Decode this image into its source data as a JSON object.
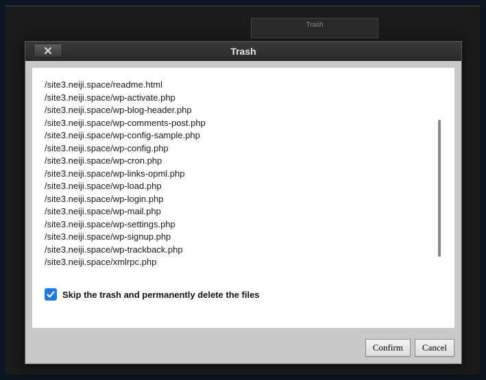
{
  "background": {
    "tab_label": "Trash"
  },
  "dialog": {
    "title": "Trash",
    "files": [
      "/site3.neiji.space/readme.html",
      "/site3.neiji.space/wp-activate.php",
      "/site3.neiji.space/wp-blog-header.php",
      "/site3.neiji.space/wp-comments-post.php",
      "/site3.neiji.space/wp-config-sample.php",
      "/site3.neiji.space/wp-config.php",
      "/site3.neiji.space/wp-cron.php",
      "/site3.neiji.space/wp-links-opml.php",
      "/site3.neiji.space/wp-load.php",
      "/site3.neiji.space/wp-login.php",
      "/site3.neiji.space/wp-mail.php",
      "/site3.neiji.space/wp-settings.php",
      "/site3.neiji.space/wp-signup.php",
      "/site3.neiji.space/wp-trackback.php",
      "/site3.neiji.space/xmlrpc.php"
    ],
    "skip_trash_checked": true,
    "skip_trash_label": "Skip the trash and permanently delete the files",
    "confirm_label": "Confirm",
    "cancel_label": "Cancel"
  }
}
